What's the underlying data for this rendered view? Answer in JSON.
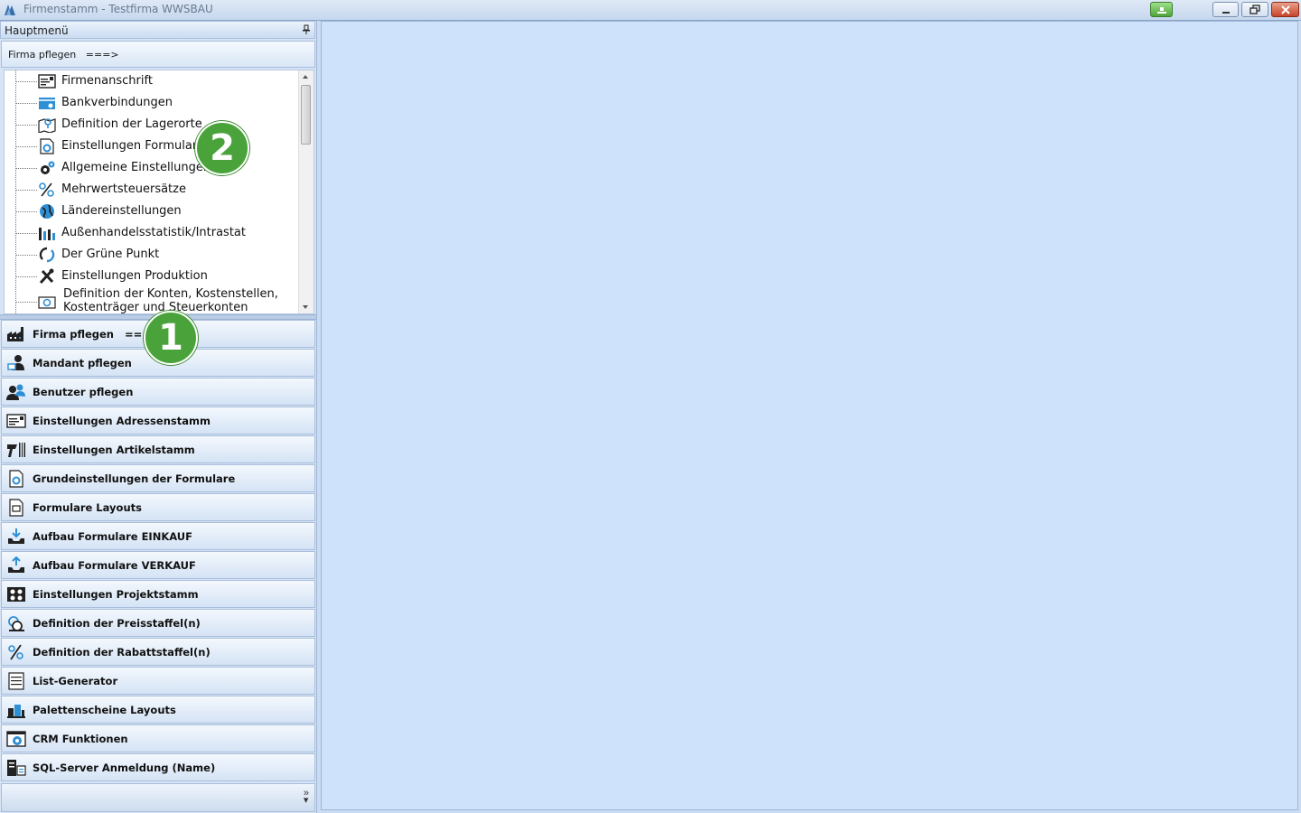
{
  "window": {
    "title": "Firmenstamm - Testfirma WWSBAU"
  },
  "panel": {
    "header": "Hauptmenü",
    "section_title": "Firma pflegen   ===>"
  },
  "tree": {
    "items": [
      {
        "label": "Firmenanschrift",
        "icon": "address-card-icon"
      },
      {
        "label": "Bankverbindungen",
        "icon": "bank-card-icon"
      },
      {
        "label": "Definition der Lagerorte",
        "icon": "map-pin-icon"
      },
      {
        "label": "Einstellungen Formulare",
        "icon": "form-settings-icon"
      },
      {
        "label": "Allgemeine Einstellungen",
        "icon": "gears-icon"
      },
      {
        "label": "Mehrwertsteuersätze",
        "icon": "percent-icon"
      },
      {
        "label": "Ländereinstellungen",
        "icon": "globe-icon"
      },
      {
        "label": "Außenhandelsstatistik/Intrastat",
        "icon": "bar-chart-icon"
      },
      {
        "label": "Der Grüne Punkt",
        "icon": "recycle-icon"
      },
      {
        "label": "Einstellungen Produktion",
        "icon": "tools-icon"
      },
      {
        "label": "Definition der Konten, Kostenstellen, Kostenträger und Steuerkonten",
        "icon": "money-icon"
      }
    ]
  },
  "nav": {
    "items": [
      {
        "label": "Firma pflegen   ===>",
        "icon": "factory-icon"
      },
      {
        "label": "Mandant pflegen",
        "icon": "client-icon"
      },
      {
        "label": "Benutzer pflegen",
        "icon": "users-icon"
      },
      {
        "label": "Einstellungen Adressenstamm",
        "icon": "address-card-icon"
      },
      {
        "label": "Einstellungen Artikelstamm",
        "icon": "barcode-scanner-icon"
      },
      {
        "label": "Grundeinstellungen der Formulare",
        "icon": "form-settings-icon"
      },
      {
        "label": "Formulare Layouts",
        "icon": "layout-icon"
      },
      {
        "label": "Aufbau Formulare EINKAUF",
        "icon": "inbox-download-icon"
      },
      {
        "label": "Aufbau Formulare VERKAUF",
        "icon": "inbox-upload-icon"
      },
      {
        "label": "Einstellungen Projektstamm",
        "icon": "project-icon"
      },
      {
        "label": "Definition der Preisstaffel(n)",
        "icon": "price-scale-icon"
      },
      {
        "label": "Definition der Rabattstaffel(n)",
        "icon": "discount-icon"
      },
      {
        "label": "List-Generator",
        "icon": "list-icon"
      },
      {
        "label": "Palettenscheine Layouts",
        "icon": "pallet-icon"
      },
      {
        "label": "CRM Funktionen",
        "icon": "crm-icon"
      },
      {
        "label": "SQL-Server Anmeldung (Name)",
        "icon": "server-icon"
      }
    ]
  },
  "badges": {
    "one": "1",
    "two": "2"
  },
  "colors": {
    "accent": "#4aa33a",
    "main_background": "#cfe2fc"
  }
}
